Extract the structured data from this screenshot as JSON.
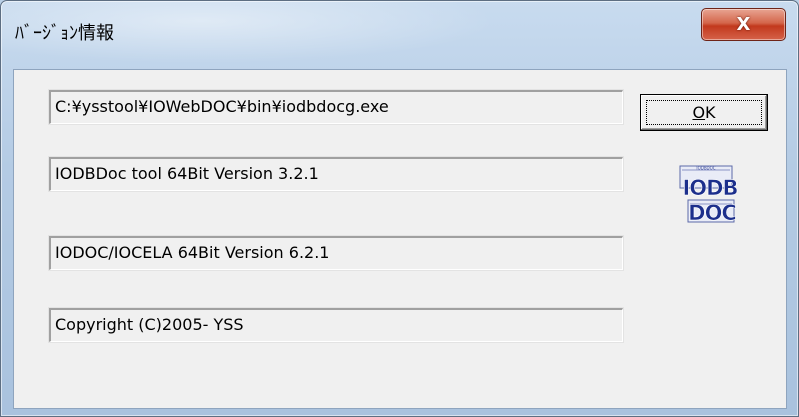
{
  "window": {
    "title": "ﾊﾞｰｼﾞｮﾝ情報",
    "close_glyph": "X"
  },
  "fields": [
    "C:¥ysstool¥IOWebDOC¥bin¥iodbdocg.exe",
    "IODBDoc tool 64Bit Version 3.2.1",
    "IODOC/IOCELA 64Bit Version 6.2.1",
    "Copyright (C)2005- YSS"
  ],
  "buttons": {
    "ok_label": "OK",
    "ok_mnemonic": "O"
  },
  "logo": {
    "icon": "iodb-doc-logo-icon",
    "line1": "IODB",
    "line2": "DOC",
    "caption": "IODBDOC"
  },
  "colors": {
    "title_bar": "#b4cbe4",
    "close_button": "#c2391d",
    "client_bg": "#f0f0f0",
    "logo_blue": "#1c2f8c"
  }
}
